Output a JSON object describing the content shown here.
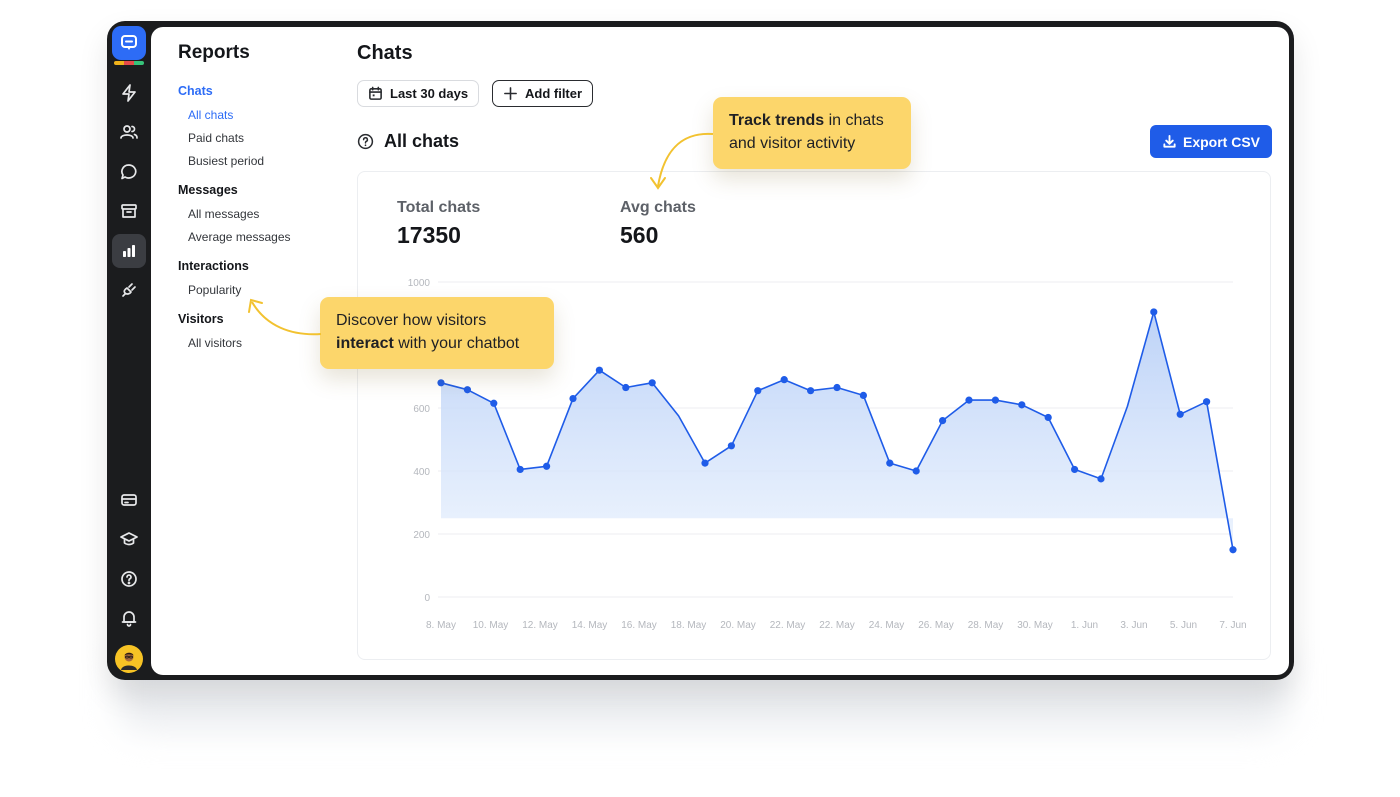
{
  "nav": {
    "title": "Reports",
    "sections": [
      {
        "label": "Chats",
        "items": [
          "All chats",
          "Paid chats",
          "Busiest period"
        ]
      },
      {
        "label": "Messages",
        "items": [
          "All messages",
          "Average messages"
        ]
      },
      {
        "label": "Interactions",
        "items": [
          "Popularity"
        ]
      },
      {
        "label": "Visitors",
        "items": [
          "All visitors"
        ]
      }
    ]
  },
  "rail": {
    "icons": [
      "lightning-icon",
      "users-icon",
      "chat-bubble-icon",
      "archive-icon",
      "reports-icon",
      "plug-icon",
      "billing-card-icon",
      "graduation-cap-icon",
      "help-icon",
      "bell-icon"
    ],
    "active": "reports-icon",
    "brand_color": "#2D6CF6"
  },
  "header": {
    "title": "Chats",
    "date_filter": "Last 30 days",
    "add_filter": "Add filter"
  },
  "section": {
    "title": "All chats",
    "export_label": "Export CSV"
  },
  "stats": {
    "total_label": "Total chats",
    "total_value": "17350",
    "avg_label": "Avg chats",
    "avg_value": "560"
  },
  "callouts": {
    "trends_bold": "Track trends",
    "trends_rest_1": " in chats",
    "trends_rest_2": "and visitor activity",
    "interact_line1": "Discover how visitors",
    "interact_bold": "interact",
    "interact_rest": " with your chatbot"
  },
  "chart_data": {
    "type": "area",
    "title": "",
    "xlabel": "",
    "ylabel": "",
    "ylim": [
      0,
      1000
    ],
    "y_ticks": [
      0,
      200,
      400,
      600,
      1000
    ],
    "x_tick_labels": [
      "8. May",
      "10. May",
      "12. May",
      "14. May",
      "16. May",
      "18. May",
      "20. May",
      "22. May",
      "22. May",
      "24. May",
      "26. May",
      "28. May",
      "30. May",
      "1. Jun",
      "3. Jun",
      "5. Jun",
      "7. Jun"
    ],
    "values": [
      680,
      658,
      615,
      405,
      415,
      630,
      720,
      665,
      680,
      575,
      425,
      480,
      655,
      690,
      655,
      665,
      640,
      425,
      400,
      560,
      625,
      625,
      610,
      570,
      405,
      375,
      605,
      905,
      580,
      620,
      150
    ],
    "marked_points": [
      0,
      1,
      2,
      3,
      4,
      5,
      6,
      7,
      8,
      10,
      11,
      12,
      13,
      14,
      15,
      16,
      17,
      18,
      19,
      20,
      21,
      22,
      23,
      24,
      25,
      27,
      28,
      29,
      30
    ],
    "grid": true,
    "line_color": "#1F5CE8"
  }
}
